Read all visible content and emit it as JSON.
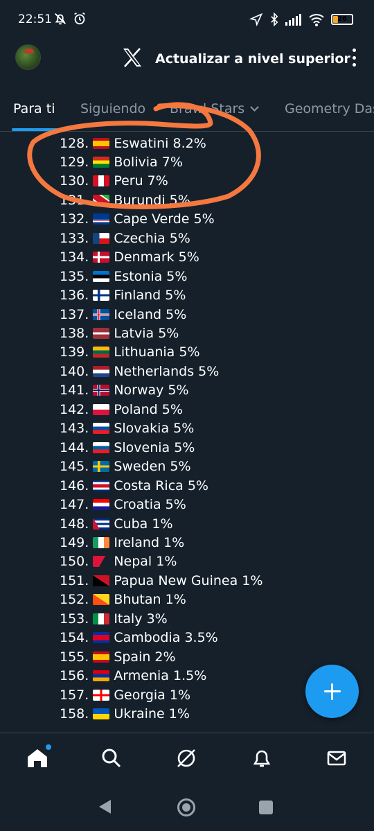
{
  "status_bar": {
    "time": "22:51",
    "battery": "26",
    "battery_level": 0.26
  },
  "header": {
    "upgrade_label": "Actualizar a nivel superior"
  },
  "tabs": [
    {
      "label": "Para ti",
      "active": true
    },
    {
      "label": "Siguiendo",
      "active": false
    },
    {
      "label": "Brawl Stars",
      "active": false
    },
    {
      "label": "Geometry Das",
      "active": false
    }
  ],
  "countries": [
    {
      "rank": "128.",
      "name": "Eswatini 8.2%",
      "flag": "es"
    },
    {
      "rank": "129.",
      "name": "Bolivia 7%",
      "flag": "bo"
    },
    {
      "rank": "130.",
      "name": "Peru 7%",
      "flag": "pe"
    },
    {
      "rank": "131.",
      "name": "Burundi 5%",
      "flag": "bi"
    },
    {
      "rank": "132.",
      "name": "Cape Verde 5%",
      "flag": "cv"
    },
    {
      "rank": "133.",
      "name": "Czechia 5%",
      "flag": "cz"
    },
    {
      "rank": "134.",
      "name": "Denmark 5%",
      "flag": "dk"
    },
    {
      "rank": "135.",
      "name": "Estonia 5%",
      "flag": "ee"
    },
    {
      "rank": "136.",
      "name": "Finland 5%",
      "flag": "fi"
    },
    {
      "rank": "137.",
      "name": "Iceland 5%",
      "flag": "is"
    },
    {
      "rank": "138.",
      "name": "Latvia 5%",
      "flag": "lv"
    },
    {
      "rank": "139.",
      "name": "Lithuania 5%",
      "flag": "lt"
    },
    {
      "rank": "140.",
      "name": "Netherlands 5%",
      "flag": "nl"
    },
    {
      "rank": "141.",
      "name": "Norway 5%",
      "flag": "no"
    },
    {
      "rank": "142.",
      "name": "Poland 5%",
      "flag": "pl"
    },
    {
      "rank": "143.",
      "name": "Slovakia 5%",
      "flag": "sk"
    },
    {
      "rank": "144.",
      "name": "Slovenia 5%",
      "flag": "si"
    },
    {
      "rank": "145.",
      "name": "Sweden 5%",
      "flag": "se"
    },
    {
      "rank": "146.",
      "name": "Costa Rica 5%",
      "flag": "cr"
    },
    {
      "rank": "147.",
      "name": "Croatia 5%",
      "flag": "hr"
    },
    {
      "rank": "148.",
      "name": "Cuba 1%",
      "flag": "cu"
    },
    {
      "rank": "149.",
      "name": "Ireland 1%",
      "flag": "ie"
    },
    {
      "rank": "150.",
      "name": "Nepal 1%",
      "flag": "np"
    },
    {
      "rank": "151.",
      "name": "Papua New Guinea 1%",
      "flag": "pg"
    },
    {
      "rank": "152.",
      "name": "Bhutan 1%",
      "flag": "bt"
    },
    {
      "rank": "153.",
      "name": "Italy 3%",
      "flag": "it"
    },
    {
      "rank": "154.",
      "name": "Cambodia 3.5%",
      "flag": "kh"
    },
    {
      "rank": "155.",
      "name": "Spain 2%",
      "flag": "es"
    },
    {
      "rank": "156.",
      "name": "Armenia 1.5%",
      "flag": "am"
    },
    {
      "rank": "157.",
      "name": "Georgia 1%",
      "flag": "ge"
    },
    {
      "rank": "158.",
      "name": "Ukraine 1%",
      "flag": "ua"
    }
  ],
  "bottom_nav": [
    "home-icon",
    "search-icon",
    "grok-icon",
    "notifications-icon",
    "messages-icon"
  ],
  "colors": {
    "background": "#15202b",
    "accent": "#1d9bf0",
    "annotation": "#f4783f"
  }
}
